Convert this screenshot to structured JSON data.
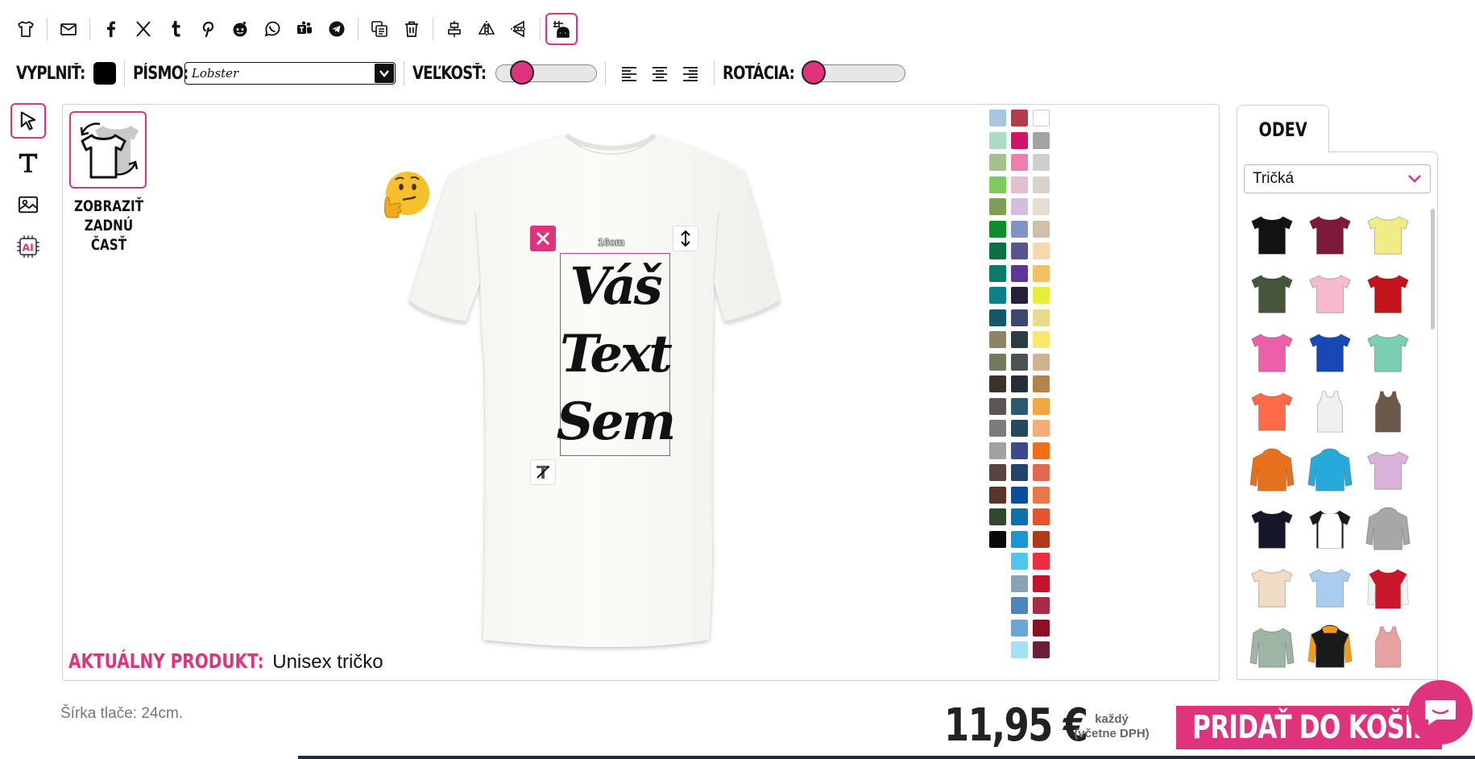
{
  "toolbar": {
    "icons": [
      "tshirt-icon",
      "mail-icon",
      "facebook-icon",
      "x-icon",
      "tumblr-icon",
      "pinterest-icon",
      "reddit-icon",
      "whatsapp-icon",
      "teams-icon",
      "telegram-icon",
      "duplicate-icon",
      "trash-icon",
      "align-center-vertical-icon",
      "flip-horizontal-icon",
      "flip-vertical-icon",
      "grid-guide-icon"
    ]
  },
  "text_toolbar": {
    "fill_label": "VYPLNIŤ:",
    "fill_color": "#000000",
    "font_label": "PÍSMO:",
    "font_value": "Lobster",
    "size_label": "VEĽKOSŤ:",
    "size_level": 0.22,
    "rotation_label": "ROTÁCIA:",
    "rotation_level": 0.0
  },
  "canvas": {
    "back_view_label_1": "ZOBRAZIŤ",
    "back_view_label_2": "ZADNÚ",
    "back_view_label_3": "ČASŤ",
    "design_lines": [
      "Váš",
      "Text",
      "Sem"
    ],
    "dimension": "16cm",
    "product_label": "AKTUÁLNY PRODUKT:",
    "product_name": "Unisex tričko"
  },
  "colors": [
    "#a8c7dc",
    "#b43b4a",
    "#ffffff",
    "#a9dcc1",
    "#d1146b",
    "#a3a3a3",
    "#a3c08d",
    "#ef7db3",
    "#cfcfcf",
    "#7fc95d",
    "#e6bfcc",
    "#d9d2cc",
    "#7f9d55",
    "#d0c0de",
    "#e6dfd1",
    "#118c2a",
    "#8192c9",
    "#cfbfa9",
    "#0d7045",
    "#5a5491",
    "#f3d9ad",
    "#0d7a67",
    "#5c3698",
    "#f2c164",
    "#0e7f88",
    "#26203a",
    "#e6ee3a",
    "#145868",
    "#3e4672",
    "#e6db8a",
    "#8f8365",
    "#2e3b47",
    "#f8e86a",
    "#6f7a5f",
    "#4a5352",
    "#cdb48e",
    "#3a3428",
    "#262f39",
    "#b4834a",
    "#5b5650",
    "#2a5971",
    "#f0a73e",
    "#7c7c7c",
    "#234b5b",
    "#f4ad74",
    "#a1a1a1",
    "#3a4a8f",
    "#f36d16",
    "#5a4240",
    "#24426e",
    "#e2694e",
    "#5a3429",
    "#0d4e9c",
    "#e9774a",
    "#2e4a2b",
    "#0d72a9",
    "#e6522a",
    "#0a0a0a",
    "#1b96d4",
    "#b23a19",
    "",
    "#4fc6ee",
    "#ef2c3f",
    "",
    "#87a4b6",
    "#c7122d",
    "",
    "#4d86bf",
    "#ab2a4a",
    "",
    "#6aa5d8",
    "#8c0f25",
    "",
    "#a5e1f5",
    "#6b2038"
  ],
  "panel": {
    "tab_label": "ODEV",
    "category_value": "Tričká",
    "garments": [
      {
        "name": "black-tshirt",
        "color": "#121212",
        "type": "tee"
      },
      {
        "name": "maroon-tshirt",
        "color": "#7d1a3a",
        "type": "tee"
      },
      {
        "name": "yellow-tshirt",
        "color": "#f2ec86",
        "type": "tee"
      },
      {
        "name": "olive-tshirt",
        "color": "#46563a",
        "type": "tee"
      },
      {
        "name": "pink-tshirt",
        "color": "#f5b9d0",
        "type": "tee"
      },
      {
        "name": "red-tshirt",
        "color": "#c4151c",
        "type": "tee"
      },
      {
        "name": "fuchsia-tshirt",
        "color": "#ec5fa9",
        "type": "tee"
      },
      {
        "name": "royal-tshirt",
        "color": "#1748b5",
        "type": "tee"
      },
      {
        "name": "mint-tshirt",
        "color": "#79cfb0",
        "type": "tee"
      },
      {
        "name": "coral-tshirt",
        "color": "#ff6a48",
        "type": "tee"
      },
      {
        "name": "white-tank",
        "color": "#f0f0f0",
        "type": "tank"
      },
      {
        "name": "brown-tank",
        "color": "#6b5a4b",
        "type": "tank"
      },
      {
        "name": "orange-hoodie",
        "color": "#e7701c",
        "type": "hoodie"
      },
      {
        "name": "cyan-hoodie",
        "color": "#27a9d9",
        "type": "hoodie"
      },
      {
        "name": "tiedye-tshirt",
        "color": "#d9b3d9",
        "type": "tee"
      },
      {
        "name": "black-tshirt-2",
        "color": "#15162a",
        "type": "tee"
      },
      {
        "name": "raglan-shirt",
        "color": "#1a1a1a",
        "type": "raglan"
      },
      {
        "name": "grey-hoodie",
        "color": "#a7a7a7",
        "type": "hoodie"
      },
      {
        "name": "beige-tshirt",
        "color": "#f0dcc2",
        "type": "tee"
      },
      {
        "name": "ombre-tshirt",
        "color": "#a9cdee",
        "type": "tee"
      },
      {
        "name": "varsity-jacket",
        "color": "#c9182c",
        "type": "jacket"
      },
      {
        "name": "sage-longsleeve",
        "color": "#9db5a5",
        "type": "longsleeve"
      },
      {
        "name": "black-orange-hoodie",
        "color": "#1a1a1a",
        "type": "hoodie"
      },
      {
        "name": "rose-tank",
        "color": "#e6a2a0",
        "type": "tank"
      }
    ]
  },
  "footer": {
    "print_width": "Šírka tlače: 24cm.",
    "price": "11,95 €",
    "price_note_1": "každý",
    "price_note_2": "(včetne DPH)",
    "cart_button": "PRIDAŤ DO KOŠÍKA"
  }
}
